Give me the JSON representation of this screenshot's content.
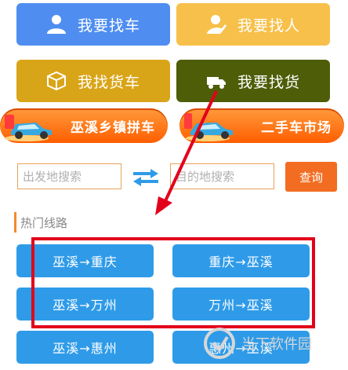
{
  "top_buttons": [
    {
      "label": "我要找车",
      "color": "#4f8ef0"
    },
    {
      "label": "我要找人",
      "color": "#f7c04a"
    },
    {
      "label": "我找货车",
      "color": "#d9a518"
    },
    {
      "label": "我要找货",
      "color": "#4e5d08"
    }
  ],
  "banners": [
    {
      "label": "巫溪乡镇拼车"
    },
    {
      "label": "二手车市场"
    }
  ],
  "search": {
    "from_placeholder": "出发地搜索",
    "to_placeholder": "目的地搜索",
    "query_label": "查询"
  },
  "section": {
    "title": "热门线路"
  },
  "routes": [
    {
      "label": "巫溪→重庆"
    },
    {
      "label": "重庆→巫溪"
    },
    {
      "label": "巫溪→万州"
    },
    {
      "label": "万州→巫溪"
    },
    {
      "label": "巫溪→惠州"
    },
    {
      "label": "惠州→巫溪"
    }
  ],
  "watermark": {
    "text": "当下软件园"
  },
  "colors": {
    "accent_orange": "#f26d21",
    "route_blue": "#2f9be8",
    "highlight_red": "#e3001b"
  }
}
